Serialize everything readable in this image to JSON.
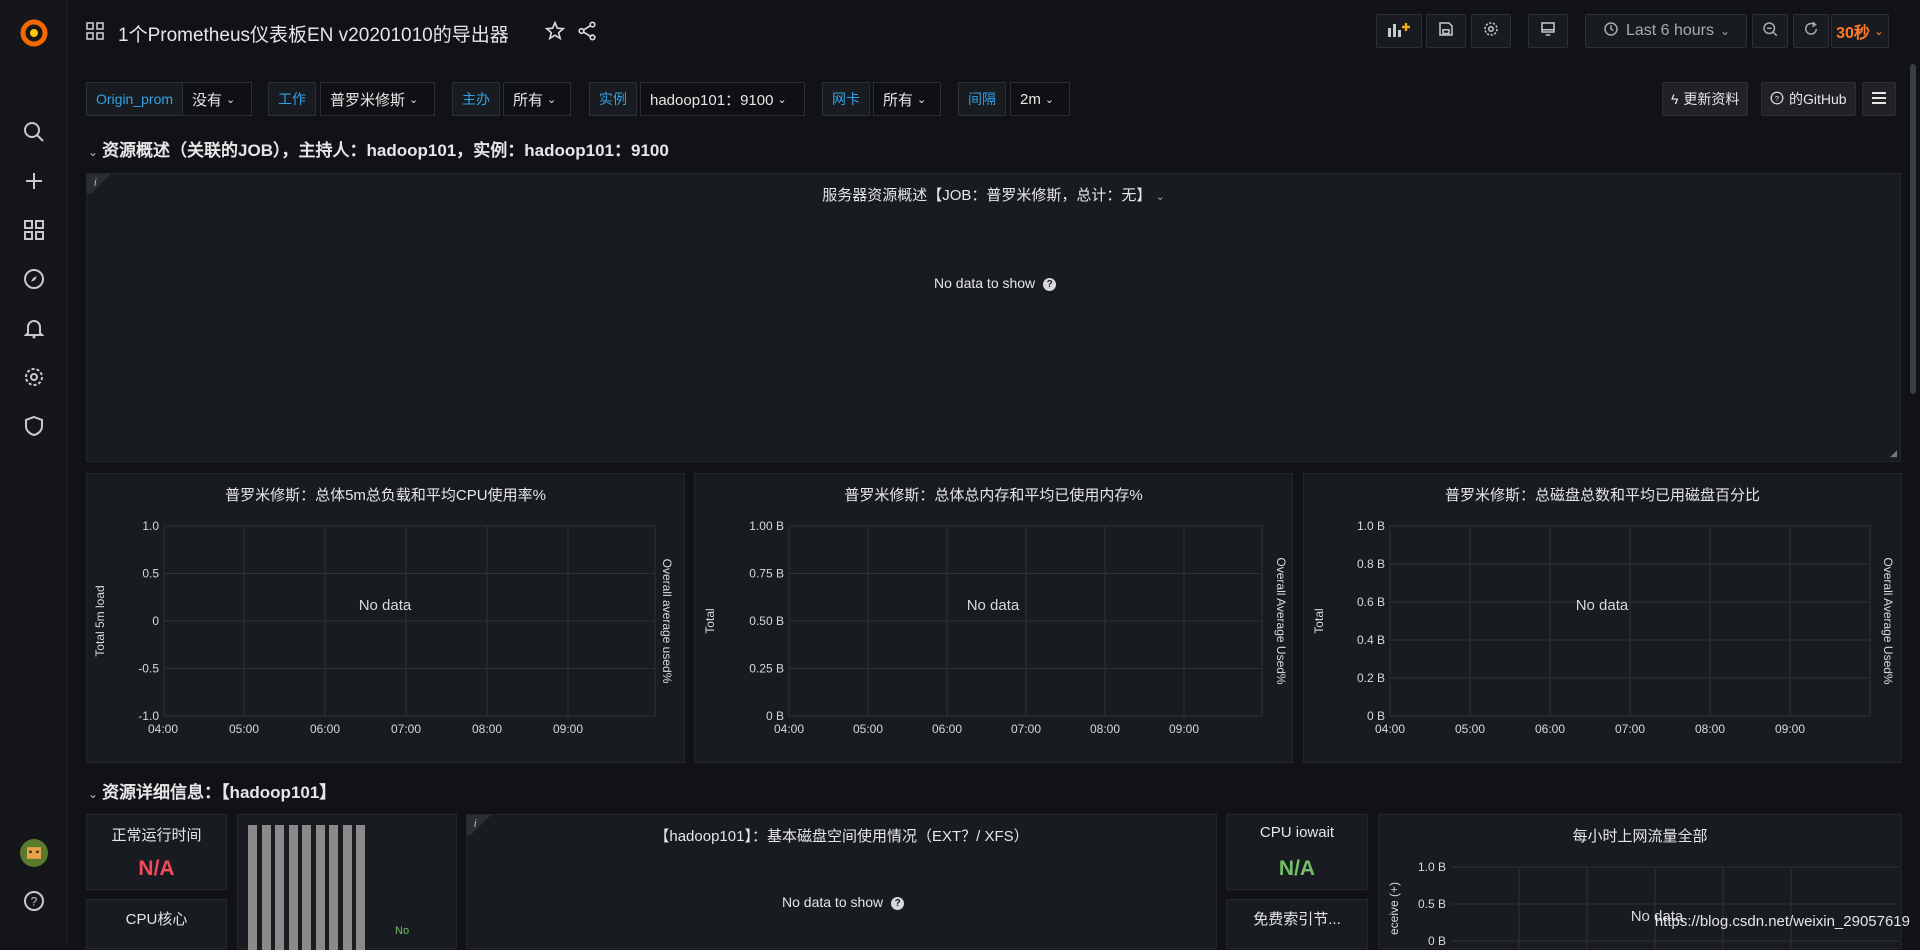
{
  "dashboard": {
    "title": "1个Prometheus仪表板EN v20201010的导出器"
  },
  "time": {
    "range_label": "Last 6 hours",
    "refresh_value": "30秒"
  },
  "variables": [
    {
      "label": "Origin_prom",
      "value": "没有"
    },
    {
      "label": "工作",
      "value": "普罗米修斯"
    },
    {
      "label": "主办",
      "value": "所有"
    },
    {
      "label": "实例",
      "value": "hadoop101：9100"
    },
    {
      "label": "网卡",
      "value": "所有"
    },
    {
      "label": "间隔",
      "value": "2m"
    }
  ],
  "links": {
    "update": "更新资料",
    "github": "的GitHub"
  },
  "rows": [
    {
      "title": "资源概述（关联的JOB），主持人：hadoop101，实例：hadoop101：9100"
    },
    {
      "title": "资源详细信息：【hadoop101】"
    }
  ],
  "panels": {
    "overview": {
      "title": "服务器资源概述【JOB：普罗米修斯，总计：无】",
      "nodata": "No data to show",
      "info": "i"
    },
    "cpu": {
      "title": "普罗米修斯：总体5m总负载和平均CPU使用率%",
      "nodata": "No data",
      "ylabel": "Total 5m load",
      "y2label": "Overall average used%"
    },
    "mem": {
      "title": "普罗米修斯：总体总内存和平均已使用内存%",
      "nodata": "No data",
      "ylabel": "Total",
      "y2label": "Overall Average Used%"
    },
    "disk": {
      "title": "普罗米修斯：总磁盘总数和平均已用磁盘百分比",
      "nodata": "No data",
      "ylabel": "Total",
      "y2label": "Overall Average Used%"
    },
    "uptime": {
      "title": "正常运行时间",
      "value": "N/A"
    },
    "cpu_cores": {
      "title": "CPU核心"
    },
    "bars": {
      "nodata": "No"
    },
    "disk_usage": {
      "title": "【hadoop101】：基本磁盘空间使用情况（EXT？/ XFS）",
      "nodata": "No data to show",
      "info": "i"
    },
    "iowait": {
      "title": "CPU iowait",
      "value": "N/A"
    },
    "free_inodes": {
      "title": "免费索引节..."
    },
    "net": {
      "title": "每小时上网流量全部",
      "nodata": "No data",
      "ylabel": "eceive (+)"
    }
  },
  "chart_data": [
    {
      "type": "line",
      "title": "普罗米修斯：总体5m总负载和平均CPU使用率%",
      "ylabel": "Total 5m load",
      "y2label": "Overall average used%",
      "x_ticks": [
        "04:00",
        "05:00",
        "06:00",
        "07:00",
        "08:00",
        "09:00"
      ],
      "y_ticks": [
        "1.0",
        "0.5",
        "0",
        "-0.5",
        "-1.0"
      ],
      "ylim": [
        -1,
        1
      ],
      "series": []
    },
    {
      "type": "line",
      "title": "普罗米修斯：总体总内存和平均已使用内存%",
      "ylabel": "Total",
      "y2label": "Overall Average Used%",
      "x_ticks": [
        "04:00",
        "05:00",
        "06:00",
        "07:00",
        "08:00",
        "09:00"
      ],
      "y_ticks": [
        "1.00 B",
        "0.75 B",
        "0.50 B",
        "0.25 B",
        "0 B"
      ],
      "ylim": [
        0,
        1
      ],
      "series": []
    },
    {
      "type": "line",
      "title": "普罗米修斯：总磁盘总数和平均已用磁盘百分比",
      "ylabel": "Total",
      "y2label": "Overall Average Used%",
      "x_ticks": [
        "04:00",
        "05:00",
        "06:00",
        "07:00",
        "08:00",
        "09:00"
      ],
      "y_ticks": [
        "1.0 B",
        "0.8 B",
        "0.6 B",
        "0.4 B",
        "0.2 B",
        "0 B"
      ],
      "ylim": [
        0,
        1
      ],
      "series": []
    },
    {
      "type": "line",
      "title": "每小时上网流量全部",
      "ylabel": "eceive (+)",
      "y_ticks": [
        "1.0 B",
        "0.5 B",
        "0 B"
      ],
      "ylim": [
        0,
        1
      ],
      "series": []
    }
  ],
  "colors": {
    "accent": "#33a2e5",
    "refresh": "#ff7b26",
    "na_red": "#f2495c",
    "na_green": "#73bf69",
    "bg": "#111217",
    "panel": "#181b1f"
  },
  "watermark": "https://blog.csdn.net/weixin_29057619"
}
